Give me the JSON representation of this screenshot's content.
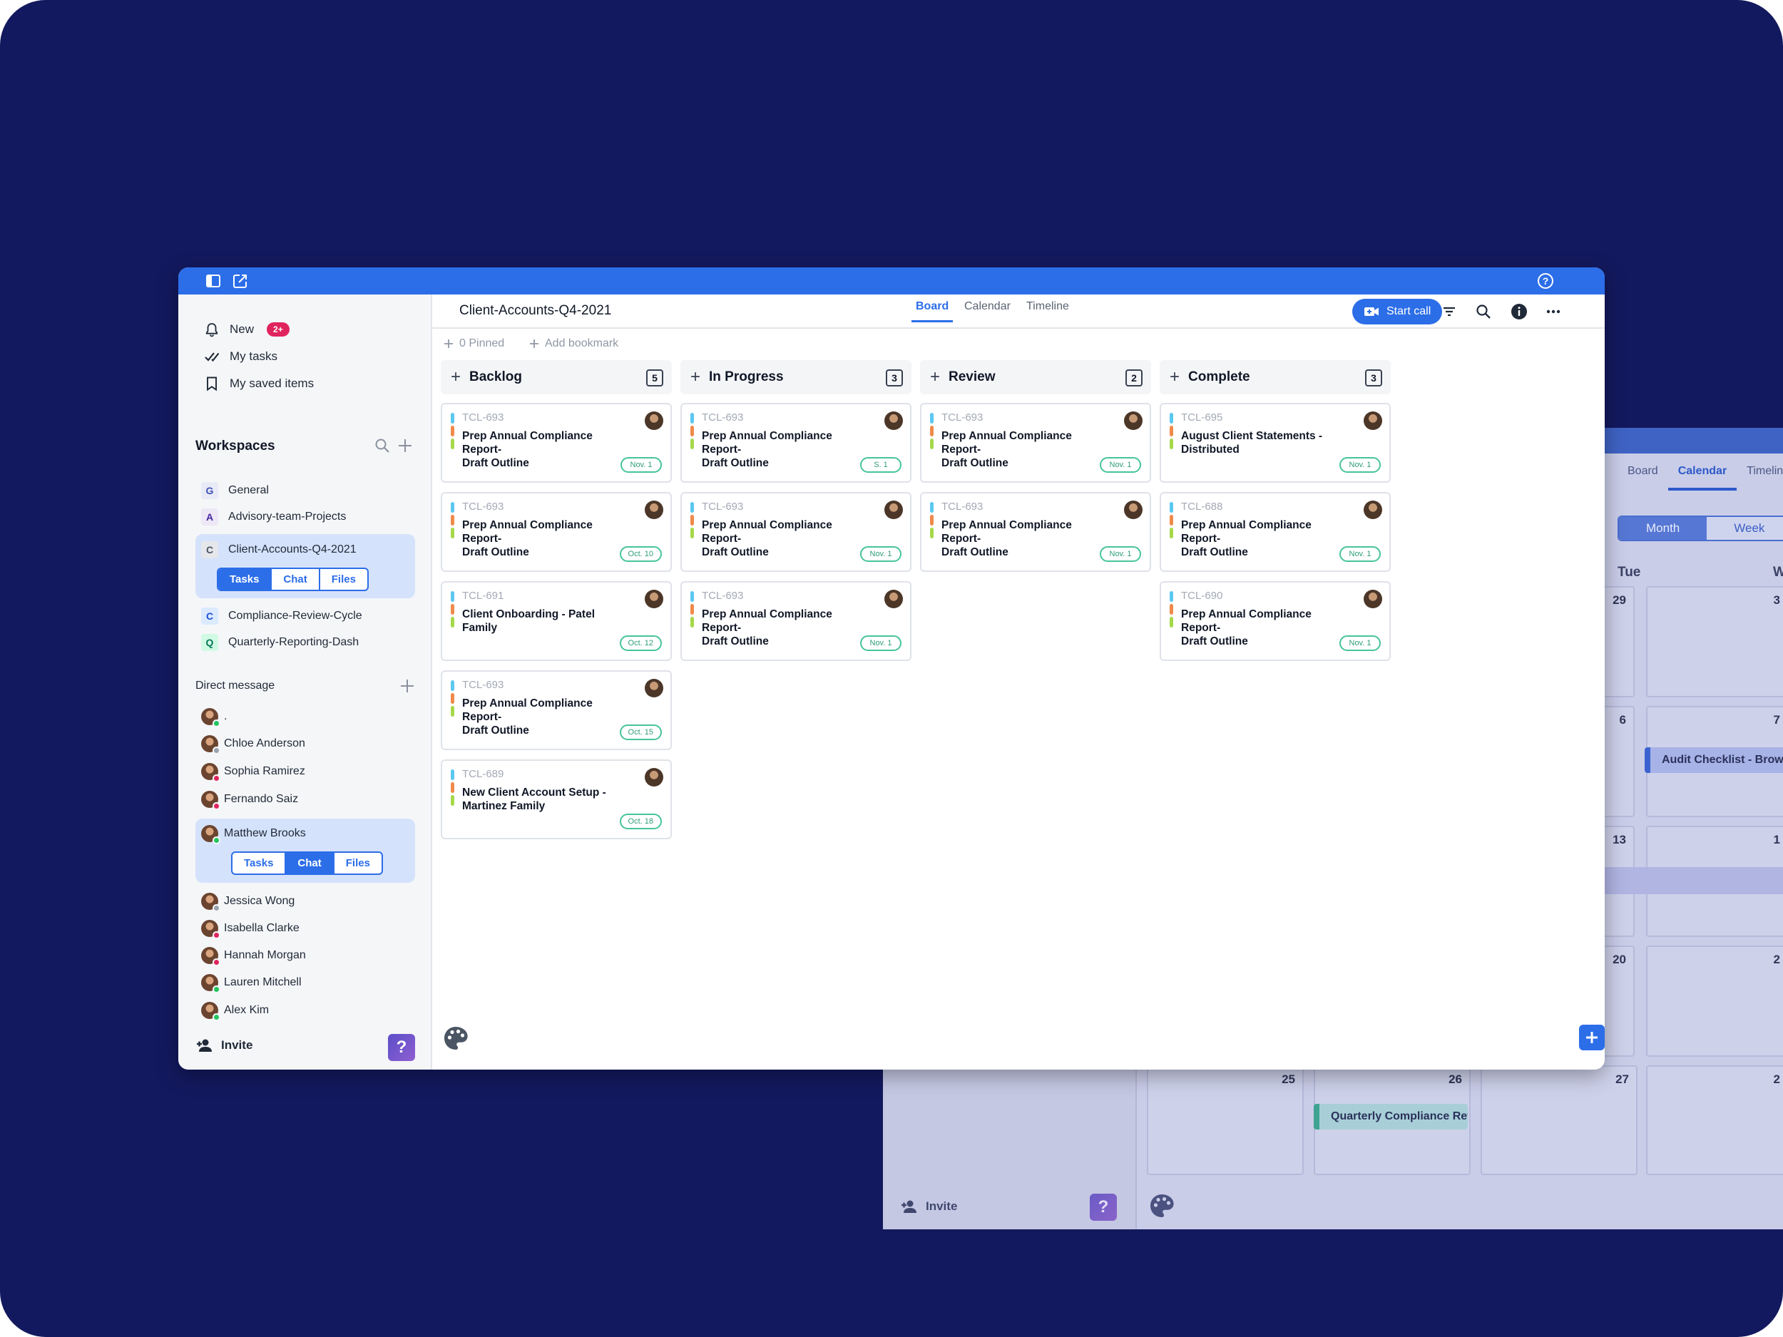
{
  "colors": {
    "brand": "#2c6ee8",
    "background": "#13195e",
    "badge": "#e0245e",
    "due_border": "#46c49a"
  },
  "titlebar": {
    "help_icon": "question-circle-icon",
    "left_icons": [
      "sidebar-toggle-icon",
      "compose-icon"
    ]
  },
  "sidebar": {
    "nav": [
      {
        "label": "New",
        "badge": "2+",
        "icon": "bell-icon"
      },
      {
        "label": "My tasks",
        "icon": "double-check-icon"
      },
      {
        "label": "My saved items",
        "icon": "bookmark-icon"
      }
    ],
    "workspaces_title": "Workspaces",
    "workspaces": [
      {
        "letter": "G",
        "name": "General"
      },
      {
        "letter": "A",
        "name": "Advisory-team-Projects"
      },
      {
        "letter": "C",
        "name": "Client-Accounts-Q4-2021"
      },
      {
        "letter": "C",
        "name": "Compliance-Review-Cycle"
      },
      {
        "letter": "Q",
        "name": "Quarterly-Reporting-Dash"
      }
    ],
    "workspace_tabs": [
      "Tasks",
      "Chat",
      "Files"
    ],
    "direct_message_title": "Direct message",
    "dms": [
      {
        "name": "."
      },
      {
        "name": "Chloe Anderson"
      },
      {
        "name": "Sophia Ramirez"
      },
      {
        "name": "Fernando Saiz"
      },
      {
        "name": "Matthew Brooks"
      },
      {
        "name": "Jessica Wong"
      },
      {
        "name": "Isabella Clarke"
      },
      {
        "name": "Hannah Morgan"
      },
      {
        "name": "Lauren Mitchell"
      },
      {
        "name": "Alex Kim"
      }
    ],
    "dm_tabs": [
      "Tasks",
      "Chat",
      "Files"
    ],
    "invite": "Invite",
    "help": "?"
  },
  "header": {
    "title": "Client-Accounts-Q4-2021",
    "tabs": [
      "Board",
      "Calendar",
      "Timeline"
    ],
    "start_call": "Start call",
    "pinned": "0 Pinned",
    "add_bookmark": "Add bookmark"
  },
  "board": {
    "columns": [
      {
        "name": "Backlog",
        "count": "5",
        "cards": [
          {
            "code": "TCL-693",
            "title": "Prep Annual Compliance\nReport-\nDraft Outline",
            "due": "Nov. 1"
          },
          {
            "code": "TCL-693",
            "title": "Prep Annual Compliance\nReport-\nDraft Outline",
            "due": "Oct. 10"
          },
          {
            "code": "TCL-691",
            "title": "Client Onboarding - Patel\nFamily",
            "due": "Oct. 12"
          },
          {
            "code": "TCL-693",
            "title": "Prep Annual Compliance\nReport-\nDraft Outline",
            "due": "Oct. 15"
          },
          {
            "code": "TCL-689",
            "title": "New Client Account Setup -\nMartinez Family",
            "due": "Oct. 18"
          }
        ]
      },
      {
        "name": "In Progress",
        "count": "3",
        "cards": [
          {
            "code": "TCL-693",
            "title": "Prep Annual Compliance\nReport-\nDraft Outline",
            "due": "S. 1"
          },
          {
            "code": "TCL-693",
            "title": "Prep Annual Compliance\nReport-\nDraft Outline",
            "due": "Nov. 1"
          },
          {
            "code": "TCL-693",
            "title": "Prep Annual Compliance\nReport-\nDraft Outline",
            "due": "Nov. 1"
          }
        ]
      },
      {
        "name": "Review",
        "count": "2",
        "cards": [
          {
            "code": "TCL-693",
            "title": "Prep Annual Compliance\nReport-\nDraft Outline",
            "due": "Nov. 1"
          },
          {
            "code": "TCL-693",
            "title": "Prep Annual Compliance\nReport-\nDraft Outline",
            "due": "Nov. 1"
          }
        ]
      },
      {
        "name": "Complete",
        "count": "3",
        "cards": [
          {
            "code": "TCL-695",
            "title": "August Client Statements -\nDistributed",
            "due": "Nov. 1"
          },
          {
            "code": "TCL-688",
            "title": "Prep Annual Compliance\nReport-\nDraft Outline",
            "due": "Nov. 1"
          },
          {
            "code": "TCL-690",
            "title": "Prep Annual Compliance\nReport-\nDraft Outline",
            "due": "Nov. 1"
          }
        ]
      }
    ]
  },
  "background_window": {
    "tabs": [
      "Board",
      "Calendar",
      "Timeline"
    ],
    "toggle": [
      "Month",
      "Week"
    ],
    "weekday_a": "Tue",
    "weekday_b": "W",
    "dates": [
      "29",
      "3",
      "6",
      "7",
      "13",
      "1",
      "20",
      "2",
      "25",
      "26",
      "27",
      "2"
    ],
    "event_audit": "Audit Checklist - Brown A",
    "event_quarterly": "Quarterly Compliance Rev...",
    "invite": "Invite",
    "help": "?"
  }
}
